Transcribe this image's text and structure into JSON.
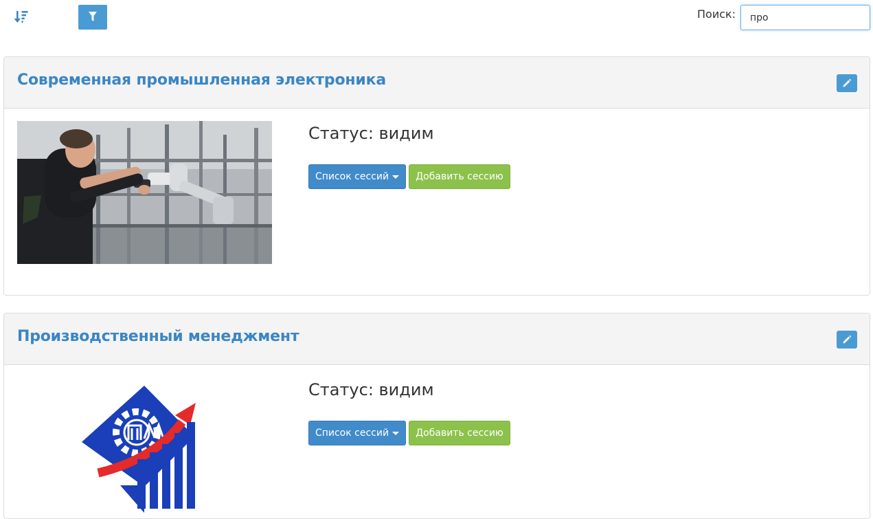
{
  "toolbar": {
    "sort_icon": "sort-amount-down-icon",
    "filter_icon": "filter-icon",
    "search_label": "Поиск:",
    "search_value": "про"
  },
  "courses": [
    {
      "title": "Современная промышленная электроника",
      "image": "photo-student-robot-arm",
      "status": "Статус: видим",
      "sessions_button": "Список сессий",
      "add_button": "Добавить сессию",
      "edit_icon": "pencil-icon"
    },
    {
      "title": "Производственный менеджмент",
      "image": "logo-pm-gear-chart",
      "status": "Статус: видим",
      "sessions_button": "Список сессий",
      "add_button": "Добавить сессию",
      "edit_icon": "pencil-icon"
    }
  ],
  "colors": {
    "accent_blue": "#428bca",
    "title_blue": "#3b86c4",
    "success_green": "#8cc14c",
    "header_bg": "#f4f4f4"
  }
}
